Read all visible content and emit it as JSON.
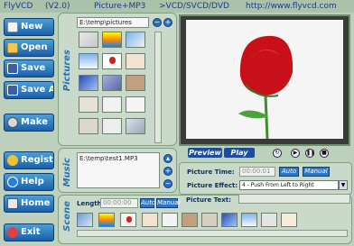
{
  "titlebar": {
    "app": "FlyVCD",
    "version": "(V2.0)",
    "mode": "Picture+MP3",
    "target": ">VCD/SVCD/DVD",
    "url": "http://www.flyvcd.com"
  },
  "buttons": [
    {
      "label": "New",
      "icon": "doc-icon"
    },
    {
      "label": "Open",
      "icon": "folder-icon"
    },
    {
      "label": "Save",
      "icon": "disk-icon"
    },
    {
      "label": "Save As",
      "icon": "disk-icon"
    },
    {
      "label": "Make",
      "icon": "gear-icon"
    },
    {
      "label": "Register",
      "icon": "key-icon"
    },
    {
      "label": "Help",
      "icon": "help-icon"
    },
    {
      "label": "Home",
      "icon": "home-icon"
    },
    {
      "label": "Exit",
      "icon": "exit-icon"
    }
  ],
  "pictures": {
    "tab": "Pictures",
    "path": "E:\\temp\\pictures",
    "minus": "−",
    "plus": "+"
  },
  "music": {
    "tab": "Music",
    "path": "E:\\temp\\test1.MP3",
    "up": "▴",
    "plus": "+",
    "minus": "−"
  },
  "scene": {
    "tab": "Scene",
    "length_label": "Length:",
    "length_value": "00:00:00",
    "auto": "Auto",
    "manual": "Manual"
  },
  "preview": {
    "preview_label": "Preview",
    "play_label": "Play"
  },
  "settings": {
    "time_label": "Picture Time:",
    "time_value": "00:00:01",
    "auto": "Auto",
    "manual": "Manual",
    "effect_label": "Picture Effect:",
    "effect_value": "4 - Push From Left to Right",
    "text_label": "Picture Text:",
    "text_value": ""
  },
  "colors": {
    "accent": "#1d4d9a",
    "panel": "#cadaca",
    "background": "#bcd0bc",
    "title": "#1e3b8a"
  }
}
